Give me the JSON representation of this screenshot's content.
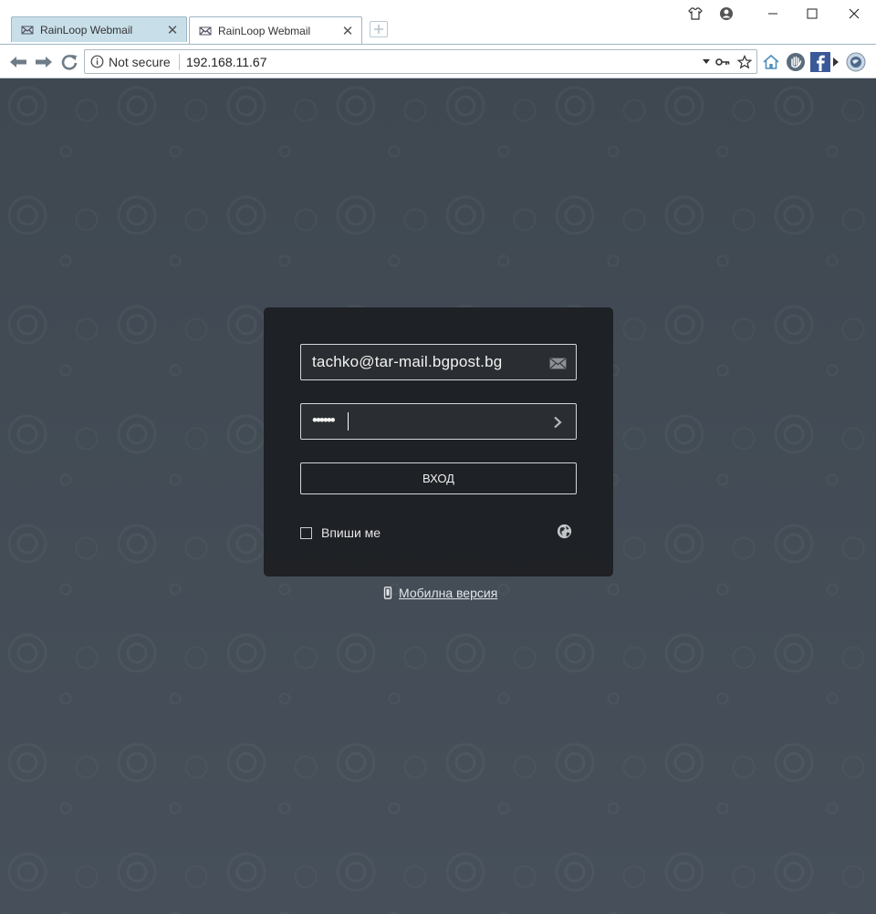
{
  "browser": {
    "tabs": [
      {
        "title": "RainLoop Webmail",
        "active": false
      },
      {
        "title": "RainLoop Webmail",
        "active": true
      }
    ],
    "close_glyph": "✕",
    "security_label": "Not secure",
    "url": "192.168.11.67",
    "window_controls": [
      "minimize-icon",
      "maximize-icon",
      "close-icon"
    ],
    "extensions": [
      "home-icon",
      "hand-icon",
      "facebook-icon",
      "more-arrow-icon",
      "globe-extension-icon"
    ]
  },
  "login": {
    "email_value": "tachko@tar-mail.bgpost.bg",
    "password_masked": "••••••",
    "submit_label": "ВХОД",
    "remember_label": "Впиши ме",
    "remember_checked": false,
    "mobile_link": "Мобилна версия"
  },
  "colors": {
    "page_background": "#414a53",
    "card_background": "#1c1e21",
    "inactive_tab": "#c8dfe9",
    "text_light": "#f2f2f2"
  }
}
